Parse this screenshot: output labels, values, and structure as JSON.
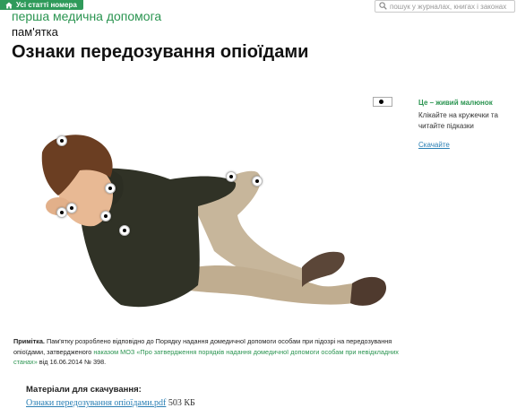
{
  "header": {
    "badge_label": "Усі статті номера",
    "badge_icon": "home-icon",
    "search_placeholder": "пошук у журналах, книгах і законах",
    "search_icon": "search-icon"
  },
  "article": {
    "journal": "перша медична допомога",
    "section": "пам'ятка",
    "title": "Ознаки передозування опіоїдами"
  },
  "side_panel": {
    "title": "Це – живий малюнок",
    "text": "Клікайте на кружечки та читайте підказки",
    "download_link": "Скачайте"
  },
  "note": {
    "label": "Примітка.",
    "text_1": " Пам'ятку розроблено відповідно до Порядку надання домедичної допомоги особам при підозрі на передозування опіоїдами, затвердженого ",
    "link": "наказом МОЗ «Про затвердження порядків надання домедичної допомоги особам при невідкладних станах»",
    "text_2": " від 16.06.2014 № 398."
  },
  "downloads": {
    "label": "Матеріали для скачування:",
    "file_name": "Ознаки передозування опіоїдами.pdf",
    "file_size": "503 КБ"
  },
  "colors": {
    "accent_green": "#2a9450",
    "badge_green": "#2f9a5a",
    "link_blue": "#2a7fb4"
  }
}
